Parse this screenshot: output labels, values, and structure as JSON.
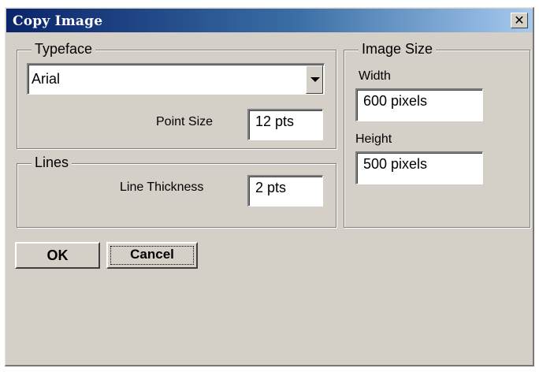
{
  "window": {
    "title": "Copy Image",
    "close_label": "✕"
  },
  "typeface": {
    "legend": "Typeface",
    "font_value": "Arial",
    "point_size_label": "Point Size",
    "point_size_value": "12  pts"
  },
  "lines": {
    "legend": "Lines",
    "thickness_label": "Line Thickness",
    "thickness_value": "2  pts"
  },
  "image_size": {
    "legend": "Image Size",
    "width_label": "Width",
    "width_value": "600 pixels",
    "height_label": "Height",
    "height_value": "500 pixels"
  },
  "buttons": {
    "ok_label": "OK",
    "cancel_label": "Cancel"
  }
}
